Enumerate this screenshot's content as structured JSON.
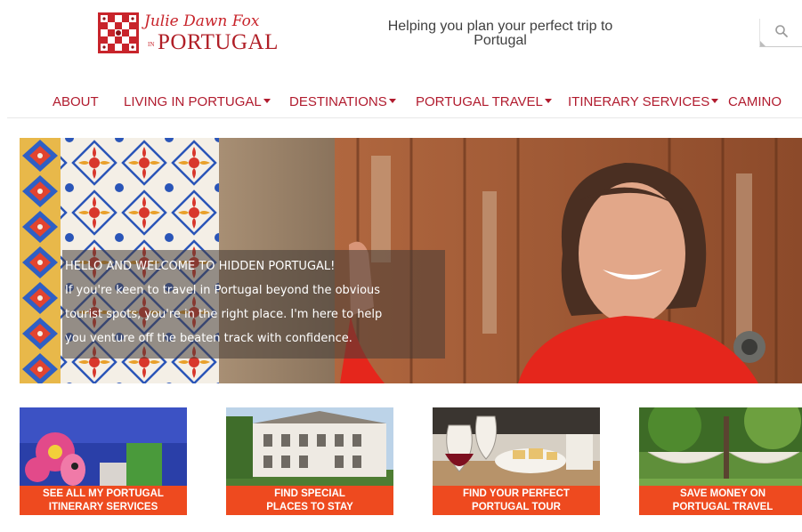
{
  "header": {
    "logo": {
      "script_text": "Julie Dawn Fox",
      "small_text": "IN",
      "country_text": "PORTUGAL"
    },
    "tagline_line1": "Helping you plan your perfect trip to",
    "tagline_line2": "Portugal",
    "search_icon": "search-icon"
  },
  "nav": {
    "items": [
      {
        "label": "ABOUT",
        "has_dropdown": false
      },
      {
        "label": "LIVING IN PORTUGAL",
        "has_dropdown": true
      },
      {
        "label": "DESTINATIONS",
        "has_dropdown": true
      },
      {
        "label": "PORTUGAL TRAVEL",
        "has_dropdown": true
      },
      {
        "label": "ITINERARY SERVICES",
        "has_dropdown": true
      },
      {
        "label": "CAMINO",
        "has_dropdown": false
      }
    ]
  },
  "hero": {
    "title": "HELLO AND WELCOME TO HIDDEN PORTUGAL!",
    "body_line1": "If you're keen to travel in Portugal beyond the obvious",
    "body_line2": "tourist spots, you're in the right place. I'm here to help",
    "body_line3": "you venture off the beaten track with confidence."
  },
  "tiles": [
    {
      "line1": "SEE ALL MY PORTUGAL",
      "line2": "ITINERARY SERVICES"
    },
    {
      "line1": "FIND SPECIAL",
      "line2": "PLACES TO STAY"
    },
    {
      "line1": "FIND YOUR PERFECT",
      "line2": "PORTUGAL TOUR"
    },
    {
      "line1": "SAVE MONEY ON",
      "line2": "PORTUGAL TRAVEL"
    }
  ],
  "colors": {
    "brand_red": "#b11b2e",
    "tile_band_orange": "#ee4a1f",
    "tagline_gray": "#404040"
  }
}
